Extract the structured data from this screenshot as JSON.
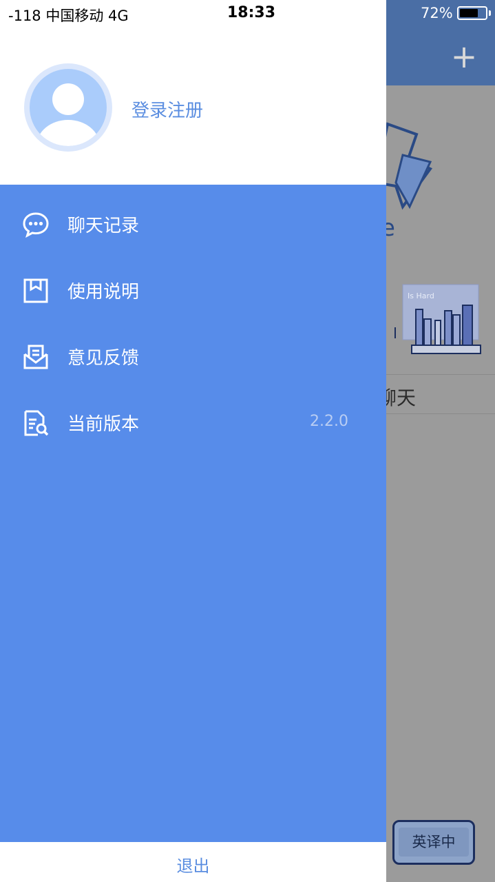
{
  "status_bar": {
    "carrier": "-118 中国移动   4G",
    "time": "18:33",
    "battery_percent": "72%",
    "battery_level": 0.72
  },
  "background_app": {
    "add_icon": "plus-icon",
    "chat_text": "聊天",
    "illustration_caption": "Is Hard",
    "translate_button": "英译中"
  },
  "drawer": {
    "avatar_icon": "user-avatar-icon",
    "login_label": "登录注册",
    "menu": [
      {
        "label": "聊天记录",
        "icon": "chat-bubble-icon",
        "value": ""
      },
      {
        "label": "使用说明",
        "icon": "bookmark-icon",
        "value": ""
      },
      {
        "label": "意见反馈",
        "icon": "mail-icon",
        "value": ""
      },
      {
        "label": "当前版本",
        "icon": "document-search-icon",
        "value": "2.2.0"
      }
    ],
    "logout_label": "退出"
  },
  "colors": {
    "drawer_blue": "#578cea",
    "header_blue": "#4a6ea5",
    "link_blue": "#5a8de0",
    "overlay_gray": "#9b9b9b"
  }
}
